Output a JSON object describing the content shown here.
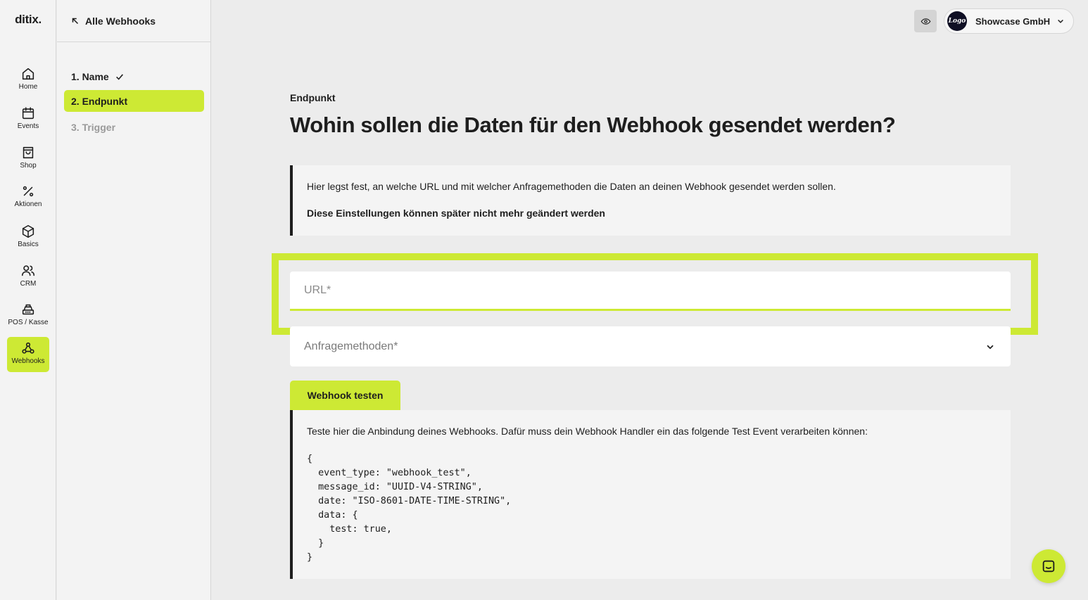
{
  "brand": {
    "logo_text": "ditix.",
    "accent_color": "#cde934"
  },
  "nav": {
    "items": [
      {
        "label": "Home",
        "icon": "home-icon"
      },
      {
        "label": "Events",
        "icon": "calendar-icon"
      },
      {
        "label": "Shop",
        "icon": "shopping-bag-icon"
      },
      {
        "label": "Aktionen",
        "icon": "percent-icon"
      },
      {
        "label": "Basics",
        "icon": "box-icon"
      },
      {
        "label": "CRM",
        "icon": "users-icon"
      },
      {
        "label": "POS / Kasse",
        "icon": "cash-register-icon"
      },
      {
        "label": "Webhooks",
        "icon": "webhook-icon",
        "active": true
      }
    ]
  },
  "steps": {
    "back_label": "Alle Webhooks",
    "items": [
      {
        "label": "1. Name",
        "state": "done"
      },
      {
        "label": "2. Endpunkt",
        "state": "active"
      },
      {
        "label": "3. Trigger",
        "state": "todo"
      }
    ]
  },
  "header": {
    "company_name": "Showcase GmbH",
    "avatar_text": "Logo"
  },
  "main": {
    "section_label": "Endpunkt",
    "title": "Wohin sollen die Daten für den Webhook gesendet werden?",
    "info_text": "Hier legst fest, an welche URL und mit welcher Anfragemethoden die Daten an deinen Webhook gesendet werden sollen.",
    "info_warning": "Diese Einstellungen können später nicht mehr geändert werden",
    "url_placeholder": "URL*",
    "url_value": "",
    "method_placeholder": "Anfragemethoden*",
    "test_button_label": "Webhook testen",
    "test_text": "Teste hier die Anbindung deines Webhooks. Dafür muss dein Webhook Handler ein das folgende Test Event verarbeiten können:",
    "test_code": "{\n  event_type: \"webhook_test\",\n  message_id: \"UUID-V4-STRING\",\n  date: \"ISO-8601-DATE-TIME-STRING\",\n  data: {\n    test: true,\n  }\n}"
  }
}
